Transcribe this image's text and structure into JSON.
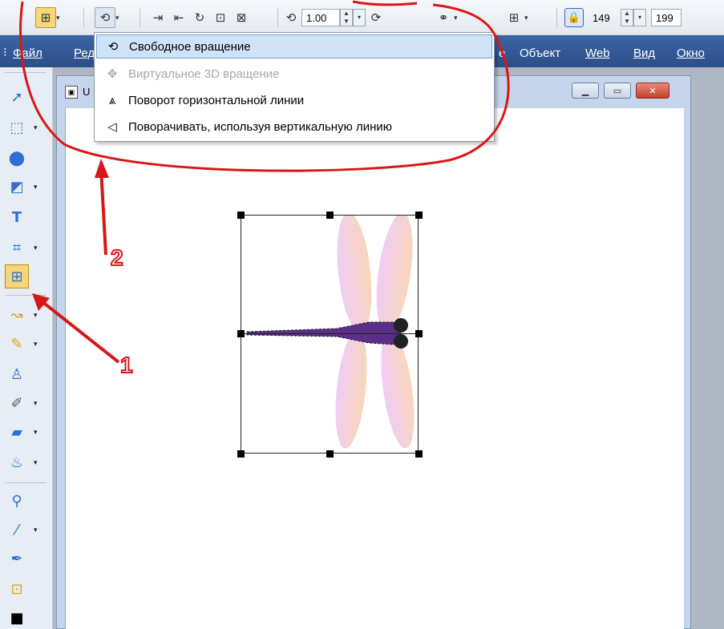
{
  "property_bar": {
    "rotation_value": "1.00",
    "width_value": "149",
    "height_value": "199"
  },
  "menu": {
    "items": [
      "Файл",
      "Ред",
      "е",
      "Объект",
      "Web",
      "Вид",
      "Окно"
    ]
  },
  "document": {
    "name": "U"
  },
  "rotate_dropdown": {
    "items": [
      {
        "label": "Свободное вращение",
        "icon": "free-rotate-icon"
      },
      {
        "label": "Виртуальное 3D вращение",
        "icon": "3d-rotate-icon"
      },
      {
        "label": "Поворот горизонтальной линии",
        "icon": "horizontal-line-rotate-icon"
      },
      {
        "label": "Поворачивать, используя вертикальную линию",
        "icon": "vertical-line-rotate-icon"
      }
    ]
  },
  "annotations": {
    "marker_1": "1",
    "marker_2": "2",
    "color": "#d81818"
  },
  "colors": {
    "menubar": "#2c4e88",
    "active_tool": "#f5d77a",
    "highlight": "#cfe3f8"
  }
}
